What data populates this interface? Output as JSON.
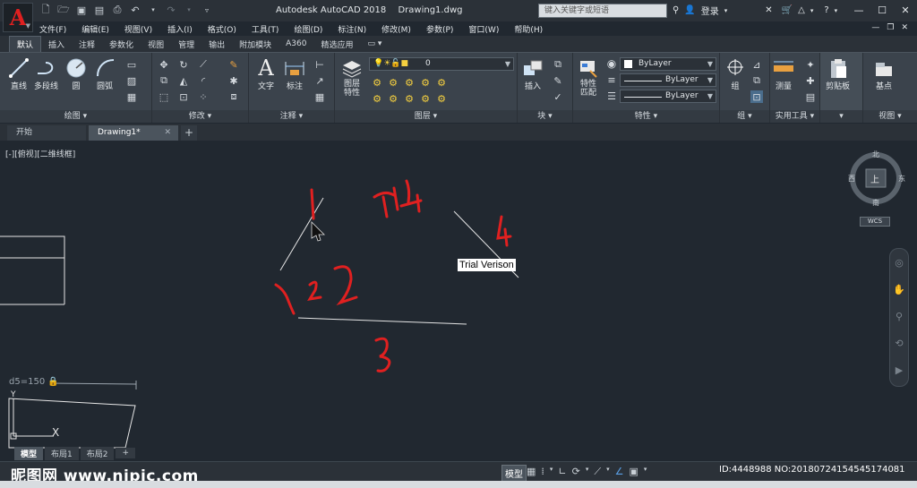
{
  "app": {
    "logo_letter": "A",
    "title": "Autodesk AutoCAD 2018",
    "filename": "Drawing1.dwg",
    "search_placeholder": "键入关键字或短语",
    "login": "登录"
  },
  "menu": [
    "文件(F)",
    "编辑(E)",
    "视图(V)",
    "插入(I)",
    "格式(O)",
    "工具(T)",
    "绘图(D)",
    "标注(N)",
    "修改(M)",
    "参数(P)",
    "窗口(W)",
    "帮助(H)"
  ],
  "ribbon_tabs": [
    "默认",
    "插入",
    "注释",
    "参数化",
    "视图",
    "管理",
    "输出",
    "附加模块",
    "A360",
    "精选应用"
  ],
  "ribbon": {
    "draw": {
      "title": "绘图",
      "line": "直线",
      "polyline": "多段线",
      "circle": "圆",
      "arc": "圆弧"
    },
    "modify": {
      "title": "修改"
    },
    "annotation": {
      "title": "注释",
      "text": "文字",
      "dim": "标注"
    },
    "layers": {
      "title": "图层",
      "layer_props": "图层\n特性",
      "layer_value": "0"
    },
    "block": {
      "title": "块",
      "insert": "插入"
    },
    "properties": {
      "title": "特性",
      "match": "特性\n匹配",
      "color": "ByLayer",
      "linetype": "ByLayer",
      "lineweight": "ByLayer"
    },
    "groups": {
      "title": "组",
      "group": "组"
    },
    "utilities": {
      "title": "实用工具",
      "measure": "测量"
    },
    "clipboard": {
      "title": "剪贴板",
      "paste": "剪贴板"
    },
    "view": {
      "title": "视图",
      "base": "基点"
    }
  },
  "file_tabs": {
    "start": "开始",
    "drawing": "Drawing1*"
  },
  "viewport_label": "[-][俯视][二维线框]",
  "compass": {
    "n": "北",
    "s": "南",
    "e": "东",
    "w": "西",
    "top": "上",
    "wcs": "WCS"
  },
  "trial_text": "Trial Verison",
  "dim_text": "d5=150",
  "layout_tabs": [
    "模型",
    "布局1",
    "布局2"
  ],
  "status": {
    "model": "模型"
  },
  "watermark": "昵图网 www.nipic.com",
  "id_mark": "ID:4448988 NO:20180724154545174081",
  "colors": {
    "accent_red": "#e02020",
    "canvas": "#212830",
    "ribbon": "#3b434c"
  }
}
